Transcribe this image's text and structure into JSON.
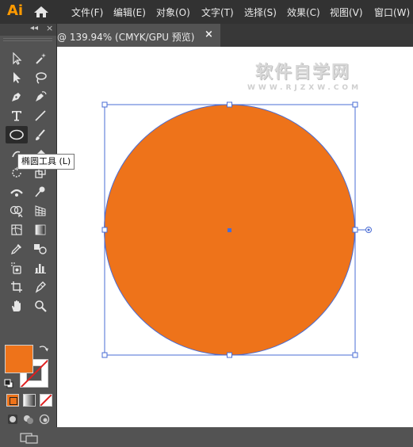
{
  "app": {
    "logo": "Ai",
    "menu": [
      "文件(F)",
      "编辑(E)",
      "对象(O)",
      "文字(T)",
      "选择(S)",
      "效果(C)",
      "视图(V)",
      "窗口(W)"
    ]
  },
  "document_tab": {
    "title": "@ 139.94% (CMYK/GPU 预览)",
    "close": "×"
  },
  "tooltip": {
    "text": "椭圆工具 (L)"
  },
  "toolbar": {
    "collapse": "◂◂",
    "close": "×",
    "tools": [
      "selection-tool",
      "magic-wand-tool",
      "direct-selection-tool",
      "lasso-tool",
      "pen-tool",
      "curvature-tool",
      "type-tool",
      "line-segment-tool",
      "ellipse-tool",
      "paintbrush-tool",
      "shaper-tool",
      "eraser-tool",
      "rotate-tool",
      "scale-tool",
      "width-tool",
      "puppet-warp-tool",
      "shape-builder-tool",
      "perspective-grid-tool",
      "mesh-tool",
      "gradient-tool",
      "eyedropper-tool",
      "blend-tool",
      "symbol-sprayer-tool",
      "column-graph-tool",
      "artboard-tool",
      "slice-tool",
      "hand-tool",
      "zoom-tool"
    ],
    "selected_tool": "ellipse-tool"
  },
  "colors": {
    "fill": "#ee731a",
    "stroke": "none",
    "selection": "#4a6cd4",
    "accent_logo": "#ff9a00"
  },
  "canvas": {
    "watermark_main": "软件自学网",
    "watermark_sub": "WWW.RJZXW.COM",
    "shape": "ellipse"
  }
}
